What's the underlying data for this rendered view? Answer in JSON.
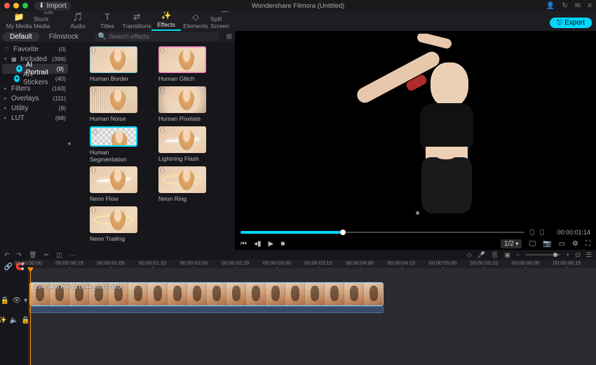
{
  "titlebar": {
    "import_label": "Import",
    "window_title": "Wondershare Filmora (Untitled)"
  },
  "toolbar": {
    "items": [
      {
        "label": "My Media",
        "icon": "📁"
      },
      {
        "label": "Stock Media",
        "icon": "🖼"
      },
      {
        "label": "Audio",
        "icon": "🎵"
      },
      {
        "label": "Titles",
        "icon": "T"
      },
      {
        "label": "Transitions",
        "icon": "⇄"
      },
      {
        "label": "Effects",
        "icon": "✨"
      },
      {
        "label": "Elements",
        "icon": "◇"
      },
      {
        "label": "Split Screen",
        "icon": "▭"
      }
    ],
    "active_index": 5,
    "export_label": "Export"
  },
  "library": {
    "tabs": [
      "Default",
      "Filmstock"
    ],
    "active_tab": 0,
    "search_placeholder": "Search effects"
  },
  "sidebar": {
    "items": [
      {
        "label": "Favorite",
        "count": "(0)",
        "icon": "♡"
      },
      {
        "label": "Included",
        "count": "(396)",
        "icon": "▦",
        "expanded": true
      },
      {
        "label": "AI Portrait",
        "count": "(9)",
        "indent": true,
        "active": true,
        "ai": true
      },
      {
        "label": "AR Stickers",
        "count": "(40)",
        "indent": true,
        "ai": true
      },
      {
        "label": "Filters",
        "count": "(160)"
      },
      {
        "label": "Overlays",
        "count": "(111)"
      },
      {
        "label": "Utility",
        "count": "(9)"
      },
      {
        "label": "LUT",
        "count": "(68)"
      }
    ]
  },
  "effects": [
    {
      "label": "Human Border",
      "fx": "fx1"
    },
    {
      "label": "Human Glitch",
      "fx": "fx2"
    },
    {
      "label": "Human Noise",
      "fx": "fx3"
    },
    {
      "label": "Human Pixelate",
      "fx": "fx4"
    },
    {
      "label": "Human Segmentation",
      "seg": true
    },
    {
      "label": "Lightning Flash",
      "flash": true
    },
    {
      "label": "Neon Flow",
      "flash": true
    },
    {
      "label": "Neon Ring",
      "ring": true
    },
    {
      "label": "Neon Trailing",
      "ring": true
    }
  ],
  "preview": {
    "timecode": "00:00:01:14",
    "ratio_label": "1/2"
  },
  "timeline": {
    "ticks": [
      "00:00:00:00",
      "00:00:00:15",
      "00:00:01:00",
      "00:00:01:15",
      "00:00:02:00",
      "00:00:02:15",
      "00:00:03:00",
      "00:00:03:15",
      "00:00:04:00",
      "00:00:04:15",
      "00:00:05:00",
      "00:00:05:15",
      "00:00:06:00",
      "00:00:06:15"
    ],
    "clip_label": "EVA_9406 Part 05 (8.44)_00:00:00:00"
  }
}
